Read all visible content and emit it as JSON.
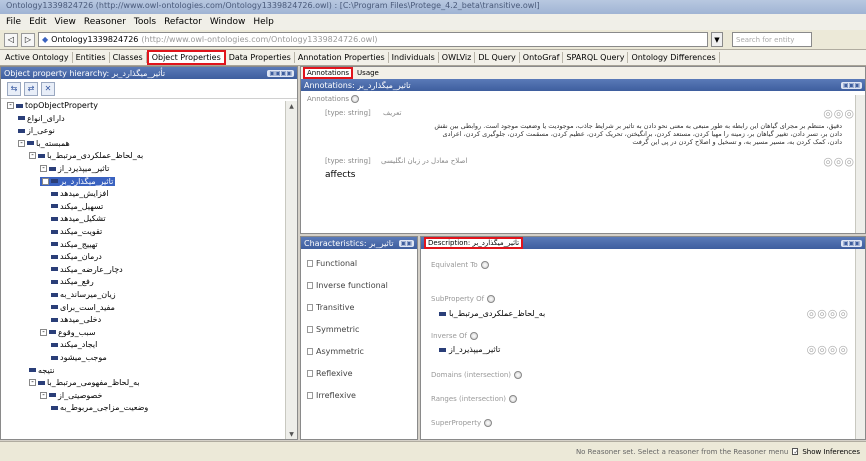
{
  "window": {
    "title": "Ontology1339824726 (http://www.owl-ontologies.com/Ontology1339824726.owl) : [C:\\Program Files\\Protege_4.2_beta\\transitive.owl]"
  },
  "menu": [
    "File",
    "Edit",
    "View",
    "Reasoner",
    "Tools",
    "Refactor",
    "Window",
    "Help"
  ],
  "address": {
    "ontology": "Ontology1339824726",
    "url": "(http://www.owl-ontologies.com/Ontology1339824726.owl)",
    "search_placeholder": "Search for entity"
  },
  "tabs": [
    "Active Ontology",
    "Entities",
    "Classes",
    "Object Properties",
    "Data Properties",
    "Annotation Properties",
    "Individuals",
    "OWLViz",
    "DL Query",
    "OntoGraf",
    "SPARQL Query",
    "Ontology Differences"
  ],
  "left": {
    "header": "Object property hierarchy: تأثیر_میگذارد_بر",
    "tree": [
      {
        "label": "topObjectProperty",
        "indent": 0,
        "exp": "-"
      },
      {
        "label": "دارای_انواع",
        "indent": 1
      },
      {
        "label": "نوعی_از",
        "indent": 1
      },
      {
        "label": "همبسته_با",
        "indent": 1,
        "exp": "-"
      },
      {
        "label": "به_لحاظ_عملکردی_مرتبط_با",
        "indent": 2,
        "exp": "-"
      },
      {
        "label": "تاثیر_میپذیرد_از",
        "indent": 3,
        "exp": "-"
      },
      {
        "label": "تاثیر_میگذارد_بر",
        "indent": 3,
        "exp": "-",
        "selected": true
      },
      {
        "label": "افزایش_میدهد",
        "indent": 4
      },
      {
        "label": "تسهیل_میکند",
        "indent": 4
      },
      {
        "label": "تشکیل_میدهد",
        "indent": 4
      },
      {
        "label": "تقویت_میکند",
        "indent": 4
      },
      {
        "label": "تهییج_میکند",
        "indent": 4
      },
      {
        "label": "درمان_میکند",
        "indent": 4
      },
      {
        "label": "دچار_عارضه_میکند",
        "indent": 4
      },
      {
        "label": "رفع_میکند",
        "indent": 4
      },
      {
        "label": "زیان_میرساند_به",
        "indent": 4
      },
      {
        "label": "مفید_است_برای",
        "indent": 4
      },
      {
        "label": "دخلی_میدهد",
        "indent": 4
      },
      {
        "label": "سبب_وقوع",
        "indent": 3,
        "exp": "-"
      },
      {
        "label": "ایجاد_میکند",
        "indent": 4
      },
      {
        "label": "موجب_میشود",
        "indent": 4
      },
      {
        "label": "نتیجه",
        "indent": 2
      },
      {
        "label": "به_لحاظ_مفهومی_مرتبط_با",
        "indent": 2,
        "exp": "-"
      },
      {
        "label": "خصوصیتی_از",
        "indent": 3,
        "exp": "-"
      },
      {
        "label": "وضعیت_مزاجی_مربوط_به",
        "indent": 4
      }
    ]
  },
  "annotations": {
    "subtabs": [
      "Annotations",
      "Usage"
    ],
    "header": "Annotations: تاثیر_میگذارد_بر",
    "section_label": "Annotations",
    "type1": "[type: string]",
    "tag1": "تعریف",
    "text_lines": [
      "دقیق، متنظم بر مجرای گیاهان این رابطه به طور منبعی به معنی نحو دادن به تاثیر بر شرایط جاذب، موجودیت یا وضعیت موجود است. روابطی بین نقش",
      "دادن بر، تسر دادن، تغییر گیاهان بر، زمینه را مهیا کردن، مستعد کردن، برانگیختن، تحریک کردن، عظیم کردن، مسقمت کردن، جلوگیری کردن، اعرادی",
      "دادن، کمک کردن به، مسیر مسیر به، و تسخیل و اصلاح کردن در پی این گرفت"
    ],
    "type2": "[type: string]",
    "tag2": "اصلاح معادل در زبان انگلیسی",
    "affects": "affects"
  },
  "characteristics": {
    "header": "Characteristics: تاثیر_بر",
    "items": [
      "Functional",
      "Inverse functional",
      "Transitive",
      "Symmetric",
      "Asymmetric",
      "Reflexive",
      "Irreflexive"
    ]
  },
  "description": {
    "header": "Description: تاثیر_میگذارد_بر",
    "equivalent_to": "Equivalent To",
    "subproperty_of": "SubProperty Of",
    "subproperty_value": "به_لحاظ_عملکردی_مرتبط_با",
    "inverse_of": "Inverse Of",
    "inverse_value": "تاثیر_میپذیرد_از",
    "domains": "Domains (intersection)",
    "ranges": "Ranges (intersection)",
    "superproperty": "SuperProperty"
  },
  "status": {
    "text": "No Reasoner set. Select a reasoner from the Reasoner menu",
    "checkbox_label": "Show Inferences"
  }
}
